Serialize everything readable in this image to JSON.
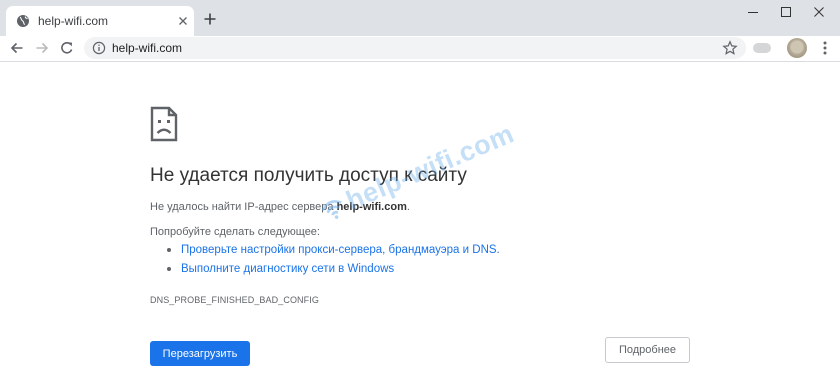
{
  "browser": {
    "tab": {
      "title": "help-wifi.com"
    },
    "address_bar": {
      "url": "help-wifi.com"
    }
  },
  "error_page": {
    "title": "Не удается получить доступ к сайту",
    "description_prefix": "Не удалось найти IP-адрес сервера ",
    "description_host": "help-wifi.com",
    "description_suffix": ".",
    "suggestions_heading": "Попробуйте сделать следующее:",
    "suggestions": [
      "Проверьте настройки прокси-сервера, брандмауэра и DNS.",
      "Выполните диагностику сети в Windows"
    ],
    "error_code": "DNS_PROBE_FINISHED_BAD_CONFIG",
    "reload_button": "Перезагрузить",
    "details_button": "Подробнее"
  },
  "watermark": {
    "text": "help-wifi.com"
  },
  "colors": {
    "accent": "#1a73e8",
    "tabstrip": "#dee1e6",
    "watermark": "#66aaeb"
  },
  "icons": {
    "tab": [
      "globe-icon",
      "close-icon",
      "plus-icon"
    ],
    "window": [
      "minimize-icon",
      "maximize-icon",
      "close-icon"
    ],
    "toolbar": [
      "back-arrow-icon",
      "forward-arrow-icon",
      "reload-icon",
      "info-icon",
      "star-icon",
      "extension-icon",
      "avatar",
      "menu-icon"
    ],
    "page": [
      "sad-page-icon",
      "wifi-icon"
    ]
  }
}
